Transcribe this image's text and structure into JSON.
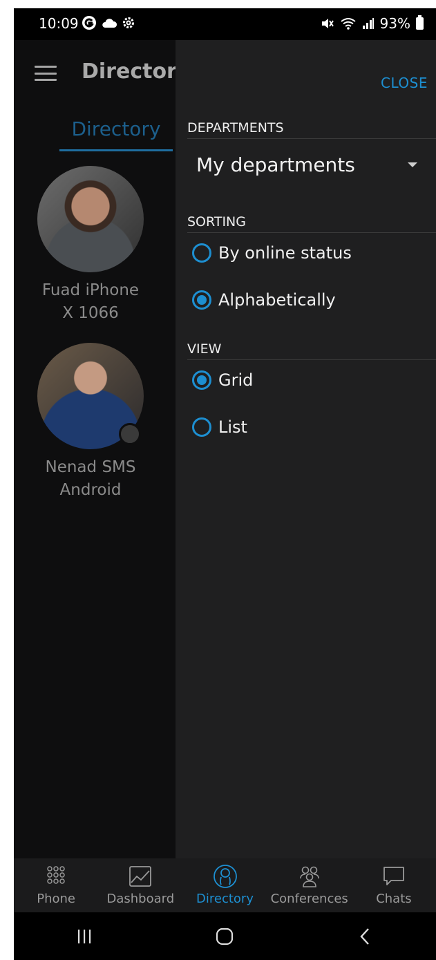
{
  "status_bar": {
    "time": "10:09",
    "battery": "93%"
  },
  "background_screen": {
    "title": "Directory",
    "tab": "Directory",
    "contacts": [
      {
        "name_line1": "Fuad iPhone",
        "name_line2": "X 1066"
      },
      {
        "name_line1": "Nenad SMS",
        "name_line2": "Android"
      }
    ]
  },
  "drawer": {
    "close_label": "CLOSE",
    "departments": {
      "title": "DEPARTMENTS",
      "selected": "My departments"
    },
    "sorting": {
      "title": "SORTING",
      "options": [
        "By online status",
        "Alphabetically"
      ],
      "selected_index": 1
    },
    "view": {
      "title": "VIEW",
      "options": [
        "Grid",
        "List"
      ],
      "selected_index": 0
    }
  },
  "bottom_nav": {
    "items": [
      "Phone",
      "Dashboard",
      "Directory",
      "Conferences",
      "Chats"
    ],
    "active": "Directory"
  },
  "colors": {
    "accent": "#1d8fd1",
    "drawer_bg": "#1f1f20",
    "nav_bg": "#1b1b1c"
  }
}
